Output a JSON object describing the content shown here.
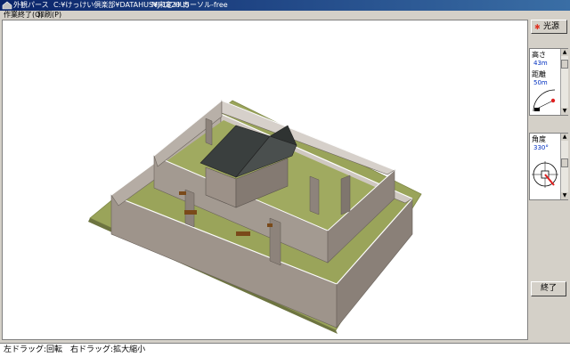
{
  "window": {
    "title": "外観パース",
    "path": "C:¥けっけい倶楽部¥DATAHUS¥未定.HUS",
    "model": "MJ-1820",
    "tool": "カーソル-free"
  },
  "menu": {
    "items": [
      "作業終了(Q)",
      "印刷(P)"
    ]
  },
  "right_panel": {
    "light_button": "光源",
    "height": {
      "label": "高さ",
      "value": "43m"
    },
    "distance": {
      "label": "距離",
      "value": "50m"
    },
    "angle": {
      "label": "角度",
      "value": "330°"
    },
    "end_button": "終了"
  },
  "status": {
    "text": "左ドラッグ:回転　右ドラッグ:拡大縮小"
  },
  "colors": {
    "ground": "#9aa45a",
    "wall": "#9c9188",
    "wall_top": "#ffffff",
    "roof": "#3a3f3e",
    "window_frame": "#7a4a1a"
  }
}
